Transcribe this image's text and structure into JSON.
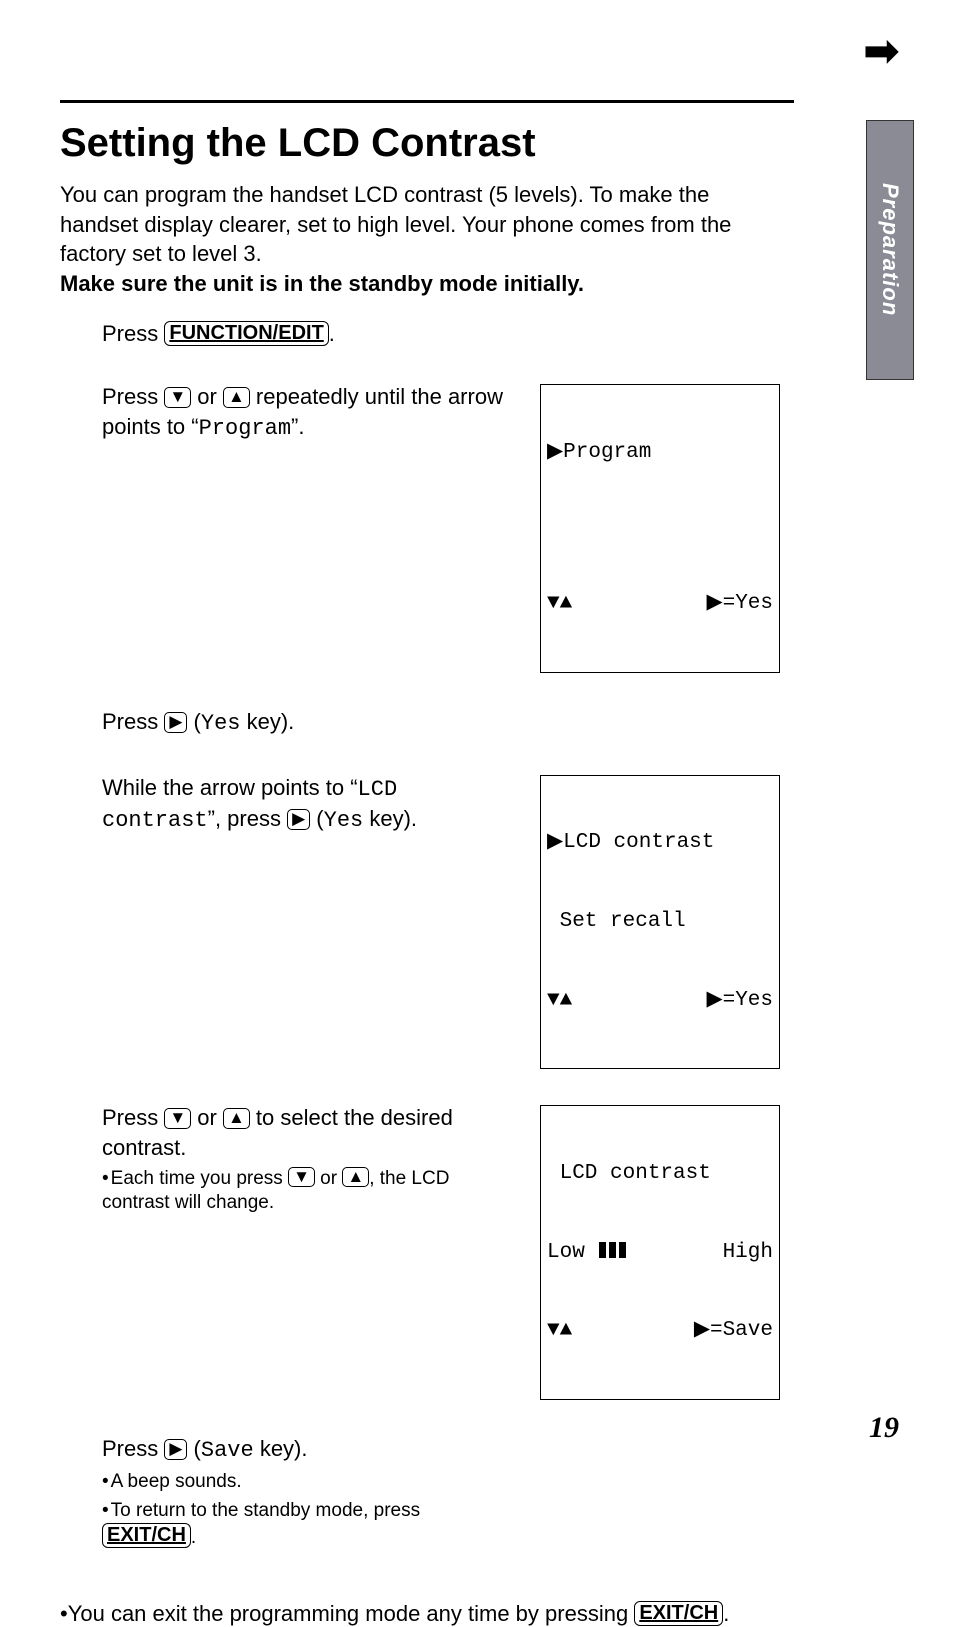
{
  "sideTab": "Preparation",
  "heading": "Setting the LCD Contrast",
  "intro": {
    "line1": "You can program the handset LCD contrast (5 levels). To make the handset display clearer, set to high level. Your phone comes from the factory set to level 3.",
    "line2": "Make sure the unit is in the standby mode initially."
  },
  "buttons": {
    "functionEdit": "FUNCTION/EDIT",
    "exitCh": "EXIT/CH"
  },
  "steps": {
    "s1": {
      "pre": "Press ",
      "post": "."
    },
    "s2": {
      "pre": "Press ",
      "mid": " or ",
      "post1": " repeatedly until the arrow points to “",
      "mono": "Program",
      "post2": "”."
    },
    "s3": {
      "pre": "Press ",
      "post1": " (",
      "mono": "Yes",
      "post2": " key)."
    },
    "s4": {
      "l1a": "While the arrow points to “",
      "l1mono": "LCD contrast",
      "l1b": "”, press ",
      "l1c": " (",
      "l1mono2": "Yes",
      "l1d": " key)."
    },
    "s5": {
      "pre": "Press ",
      "mid": " or ",
      "post": " to select the desired contrast.",
      "sub1a": "Each time you press ",
      "sub1mid": " or ",
      "sub1b": ", the LCD contrast will change."
    },
    "s6": {
      "pre": "Press ",
      "post1": " (",
      "mono": "Save",
      "post2": " key).",
      "sub1": "A beep sounds.",
      "sub2a": "To return to the standby mode, press ",
      "sub2b": "."
    }
  },
  "lcd1": {
    "row1": "▶Program",
    "row3l": "▼▲",
    "row3r": "▶=Yes"
  },
  "lcd2": {
    "row1": "▶LCD contrast",
    "row2": " Set recall",
    "row3l": "▼▲",
    "row3r": "▶=Yes"
  },
  "lcd3": {
    "row1": " LCD contrast",
    "row2l": "Low",
    "row2r": "High",
    "row3l": "▼▲",
    "row3r": "▶=Save"
  },
  "footer": {
    "pre": "•You can exit the programming mode any time by pressing ",
    "post": "."
  },
  "pageNumber": "19",
  "chart_data": {
    "type": "table",
    "title": "LCD contrast setting",
    "note": "Handset LCD contrast adjustable in 5 levels; factory default level 3; example shows 3 of 5 bars between Low and High.",
    "levels": 5,
    "default_level": 3,
    "example_level": 3
  }
}
